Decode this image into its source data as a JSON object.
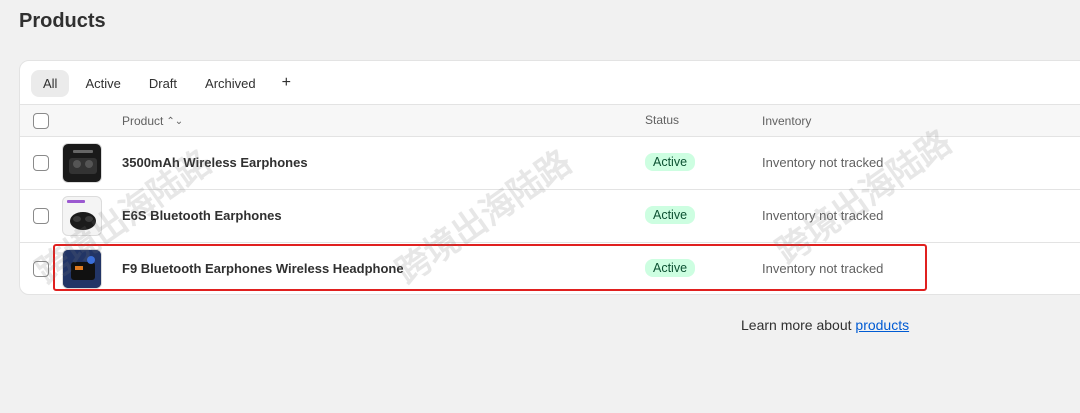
{
  "page": {
    "title": "Products"
  },
  "tabs": [
    {
      "label": "All",
      "selected": true
    },
    {
      "label": "Active",
      "selected": false
    },
    {
      "label": "Draft",
      "selected": false
    },
    {
      "label": "Archived",
      "selected": false
    },
    {
      "label": "+",
      "selected": false
    }
  ],
  "table": {
    "headers": {
      "product": "Product",
      "status": "Status",
      "inventory": "Inventory"
    },
    "sort_icon": "sort-icon",
    "rows": [
      {
        "name": "3500mAh Wireless Earphones",
        "status": "Active",
        "inventory": "Inventory not tracked"
      },
      {
        "name": "E6S Bluetooth Earphones",
        "status": "Active",
        "inventory": "Inventory not tracked"
      },
      {
        "name": "F9 Bluetooth Earphones Wireless Headphone",
        "status": "Active",
        "inventory": "Inventory not tracked"
      }
    ]
  },
  "footer": {
    "text": "Learn more about ",
    "link": "products"
  },
  "watermark": "跨境出海陆路",
  "colors": {
    "background": "#f1f1f1",
    "card": "#ffffff",
    "badge_bg": "#cdfee1",
    "badge_text": "#0c5132",
    "highlight": "#e0201f",
    "link": "#005bd3"
  }
}
